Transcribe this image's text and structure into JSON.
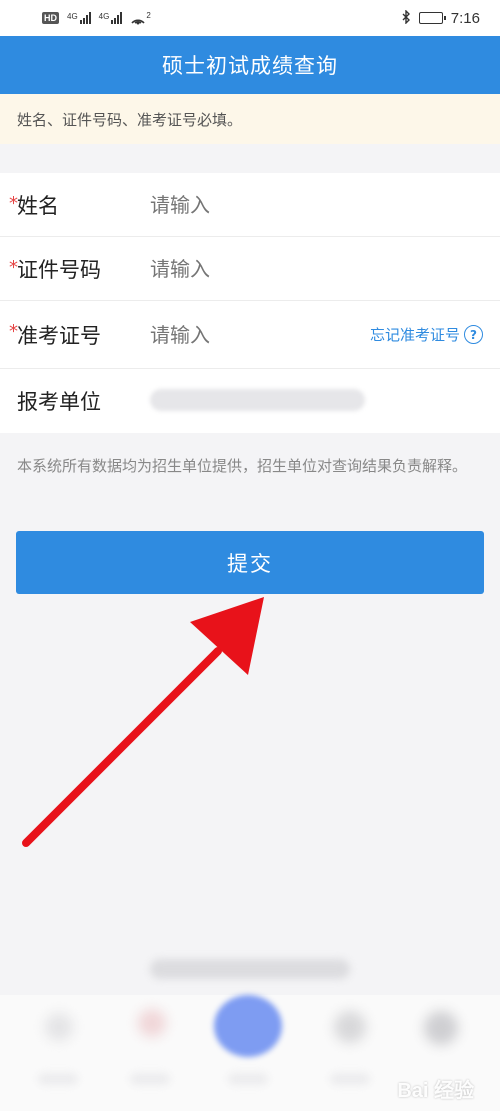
{
  "status_bar": {
    "hd": "HD",
    "sim1": "4G",
    "sim2": "4G",
    "hotspot": "2",
    "time": "7:16"
  },
  "header": {
    "title": "硕士初试成绩查询"
  },
  "notice": {
    "text": "姓名、证件号码、准考证号必填。"
  },
  "form": {
    "required_mark": "*",
    "name": {
      "label": "姓名",
      "placeholder": "请输入"
    },
    "id_number": {
      "label": "证件号码",
      "placeholder": "请输入"
    },
    "exam_number": {
      "label": "准考证号",
      "placeholder": "请输入",
      "forgot_label": "忘记准考证号",
      "help_icon": "question-circle-icon"
    },
    "unit": {
      "label": "报考单位"
    }
  },
  "disclaimer": "本系统所有数据均为招生单位提供，招生单位对查询结果负责解释。",
  "submit": {
    "label": "提交"
  },
  "watermark": "Bai 经验",
  "colors": {
    "accent": "#2f8be0",
    "required": "#e54545",
    "notice_bg": "#fdf7e9",
    "annotation_arrow": "#e8121a"
  }
}
